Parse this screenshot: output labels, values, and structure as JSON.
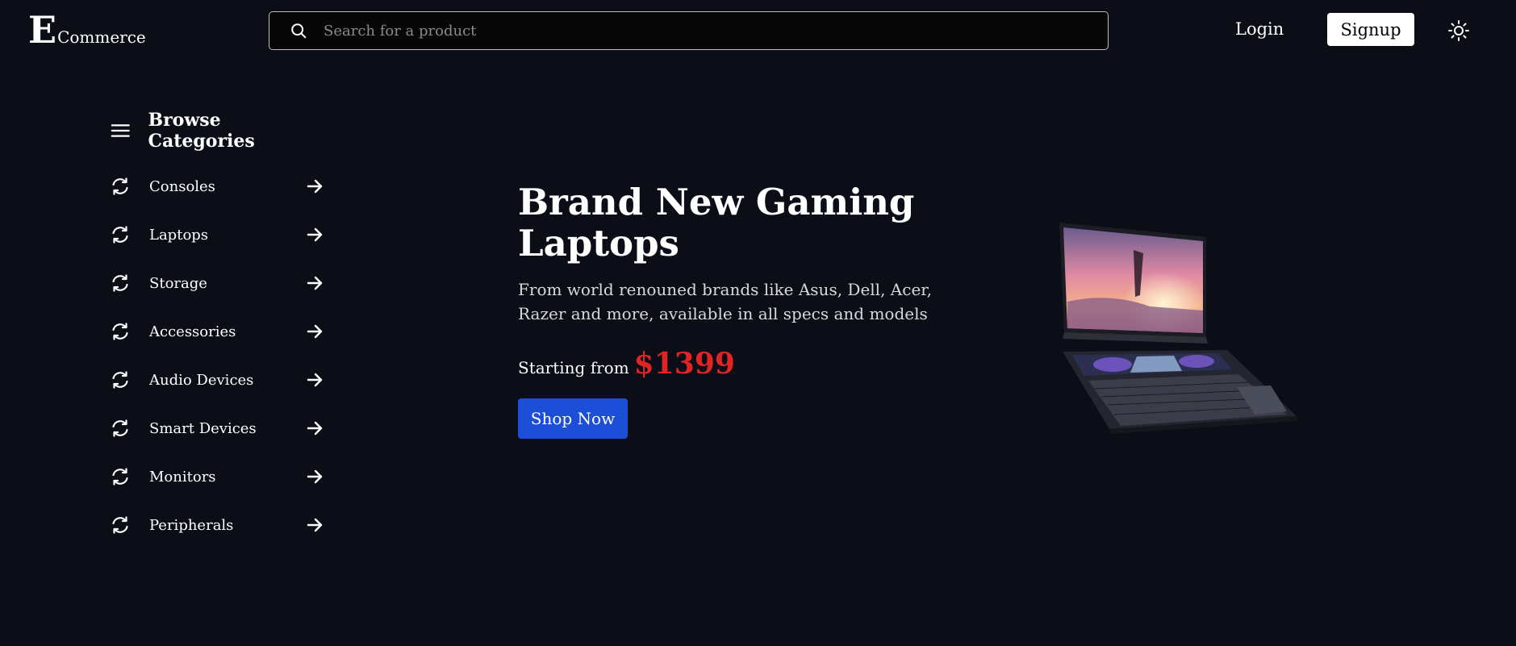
{
  "header": {
    "logo_initial": "E",
    "logo_rest": "Commerce",
    "search_placeholder": "Search for a product",
    "login_label": "Login",
    "signup_label": "Signup",
    "theme_icon": "sun-icon"
  },
  "sidebar": {
    "title": "Browse Categories",
    "items": [
      {
        "label": "Consoles"
      },
      {
        "label": "Laptops"
      },
      {
        "label": "Storage"
      },
      {
        "label": "Accessories"
      },
      {
        "label": "Audio Devices"
      },
      {
        "label": "Smart Devices"
      },
      {
        "label": "Monitors"
      },
      {
        "label": "Peripherals"
      }
    ]
  },
  "hero": {
    "title": "Brand New Gaming Laptops",
    "description": "From world renouned brands like Asus, Dell, Acer, Razer and more, available in all specs and models",
    "price_label": "Starting from",
    "price": "$1399",
    "cta_label": "Shop Now"
  },
  "colors": {
    "background": "#0b0e17",
    "accent": "#1d4ed8",
    "price": "#e02424"
  }
}
